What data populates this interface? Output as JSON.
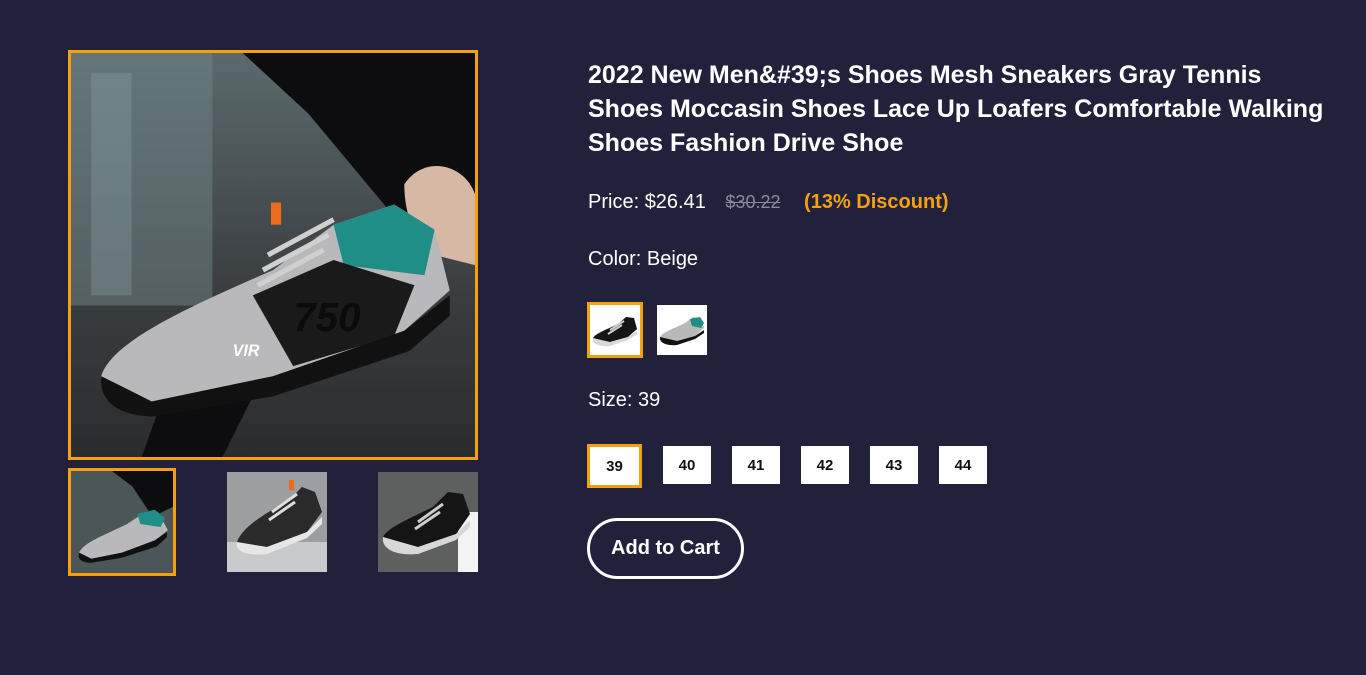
{
  "gallery": {
    "main_image": "sneaker-photo",
    "thumbnails": [
      "sneaker-photo-1",
      "sneaker-photo-2",
      "sneaker-photo-3"
    ],
    "selected_index": 0
  },
  "product": {
    "title": "2022 New Men&#39;s Shoes Mesh Sneakers Gray Tennis Shoes Moccasin Shoes Lace Up Loafers Comfortable Walking Shoes Fashion Drive Shoe",
    "price_label": "Price:",
    "price": "$26.41",
    "old_price": "$30.22",
    "discount": "(13% Discount)"
  },
  "color": {
    "label": "Color: Beige",
    "options": [
      "sneaker-black-swatch",
      "sneaker-grey-swatch"
    ],
    "selected_index": 0
  },
  "size": {
    "label": "Size: 39",
    "options": [
      "39",
      "40",
      "41",
      "42",
      "43",
      "44"
    ],
    "selected_index": 0
  },
  "cart": {
    "button_label": "Add to Cart"
  },
  "colors": {
    "background": "#22213b",
    "accent": "#f5a10f"
  }
}
